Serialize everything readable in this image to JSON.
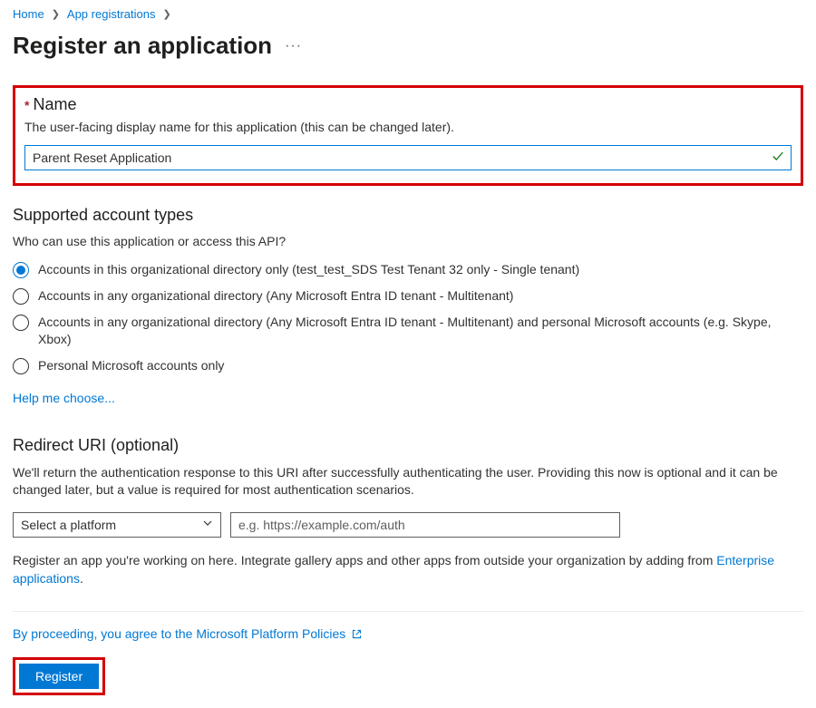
{
  "breadcrumb": {
    "home": "Home",
    "appreg": "App registrations"
  },
  "page": {
    "title": "Register an application"
  },
  "nameSection": {
    "label": "Name",
    "help": "The user-facing display name for this application (this can be changed later).",
    "value": "Parent Reset Application"
  },
  "accountTypes": {
    "heading": "Supported account types",
    "sub": "Who can use this application or access this API?",
    "options": [
      "Accounts in this organizational directory only (test_test_SDS Test Tenant 32 only - Single tenant)",
      "Accounts in any organizational directory (Any Microsoft Entra ID tenant - Multitenant)",
      "Accounts in any organizational directory (Any Microsoft Entra ID tenant - Multitenant) and personal Microsoft accounts (e.g. Skype, Xbox)",
      "Personal Microsoft accounts only"
    ],
    "helpLink": "Help me choose..."
  },
  "redirect": {
    "heading": "Redirect URI (optional)",
    "desc": "We'll return the authentication response to this URI after successfully authenticating the user. Providing this now is optional and it can be changed later, but a value is required for most authentication scenarios.",
    "platformPlaceholder": "Select a platform",
    "uriPlaceholder": "e.g. https://example.com/auth",
    "notePrefix": "Register an app you're working on here. Integrate gallery apps and other apps from outside your organization by adding from ",
    "noteLink": "Enterprise applications",
    "noteSuffix": "."
  },
  "footer": {
    "policyPrefix": "By proceeding, you agree to the ",
    "policyLink": "Microsoft Platform Policies",
    "registerLabel": "Register"
  }
}
